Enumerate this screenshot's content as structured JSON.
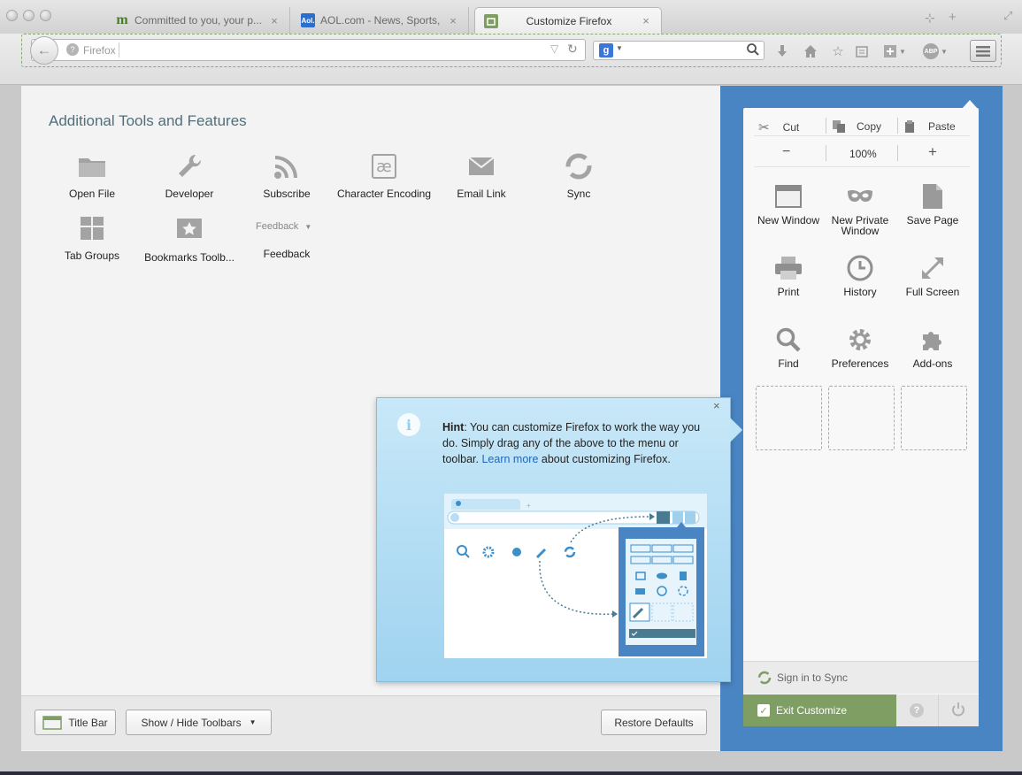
{
  "tabs": [
    {
      "title": "Committed to you, your p...",
      "favicon": "m-icon",
      "active": false
    },
    {
      "title": "AOL.com - News, Sports, ...",
      "favicon": "aol-icon",
      "active": false
    },
    {
      "title": "Customize Firefox",
      "favicon": "customize-icon",
      "active": true
    }
  ],
  "urlbar": {
    "placeholder": "Firefox"
  },
  "palette": {
    "title": "Additional Tools and Features",
    "items": [
      {
        "label": "Open File",
        "icon": "folder-icon"
      },
      {
        "label": "Developer",
        "icon": "wrench-icon"
      },
      {
        "label": "Subscribe",
        "icon": "rss-icon"
      },
      {
        "label": "Character Encoding",
        "icon": "ae-icon"
      },
      {
        "label": "Email Link",
        "icon": "envelope-icon"
      },
      {
        "label": "Sync",
        "icon": "sync-icon"
      },
      {
        "label": "Tab Groups",
        "icon": "tab-groups-icon"
      },
      {
        "label": "Bookmarks Toolb...",
        "icon": "bookmark-star-icon"
      },
      {
        "label": "Feedback",
        "icon": "feedback-dropdown"
      }
    ],
    "feedback_select": "Feedback"
  },
  "menu_panel": {
    "edit": {
      "cut": "Cut",
      "copy": "Copy",
      "paste": "Paste"
    },
    "zoom": {
      "minus": "−",
      "level": "100%",
      "plus": "+"
    },
    "items": [
      {
        "label": "New Window",
        "icon": "window-icon"
      },
      {
        "label": "New Private Window",
        "icon": "mask-icon"
      },
      {
        "label": "Save Page",
        "icon": "page-icon"
      },
      {
        "label": "Print",
        "icon": "printer-icon"
      },
      {
        "label": "History",
        "icon": "clock-icon"
      },
      {
        "label": "Full Screen",
        "icon": "fullscreen-icon"
      },
      {
        "label": "Find",
        "icon": "magnifier-icon"
      },
      {
        "label": "Preferences",
        "icon": "gear-icon"
      },
      {
        "label": "Add-ons",
        "icon": "puzzle-icon"
      }
    ],
    "sync": "Sign in to Sync",
    "exit": "Exit Customize"
  },
  "hint": {
    "bold": "Hint",
    "text1": ": You can customize Firefox to work the way you do. Simply drag any of the above to the menu or toolbar. ",
    "link": "Learn more",
    "text2": " about customizing Firefox."
  },
  "bottom_bar": {
    "title_bar": "Title Bar",
    "toolbars": "Show / Hide Toolbars",
    "restore": "Restore Defaults"
  },
  "colors": {
    "accent_blue": "#4a85c3",
    "exit_green": "#7f9e64",
    "hint_bg": "#bfe4f6"
  }
}
